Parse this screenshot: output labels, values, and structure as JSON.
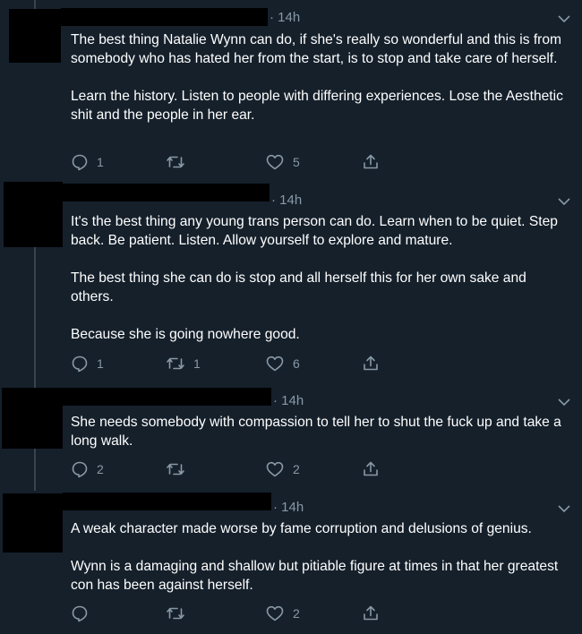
{
  "tweets": [
    {
      "time": "· 14h",
      "paragraphs": [
        "The best thing Natalie Wynn can do, if she's really so wonderful and this is from somebody who has hated her from the start, is to stop and take care of herself.",
        "Learn the history. Listen to people with differing experiences. Lose the Aesthetic shit and the people in her ear."
      ],
      "replies": "1",
      "retweets": "",
      "likes": "5"
    },
    {
      "time": "· 14h",
      "paragraphs": [
        "It's the best thing any young trans person can do. Learn when to be quiet. Step back. Be patient. Listen. Allow yourself to explore and mature.",
        "The best thing she can do is stop and all herself this for her own sake and others.",
        "Because she is going nowhere good."
      ],
      "replies": "1",
      "retweets": "1",
      "likes": "6"
    },
    {
      "time": "· 14h",
      "paragraphs": [
        "She needs somebody with compassion to tell her to shut the fuck up and take a long walk."
      ],
      "replies": "2",
      "retweets": "",
      "likes": "2"
    },
    {
      "time": "· 14h",
      "paragraphs": [
        "A weak character made worse by fame corruption and delusions of genius.",
        "Wynn is a damaging and shallow but pitiable figure at times in that her greatest con has been against herself."
      ],
      "replies": "",
      "retweets": "",
      "likes": "2"
    }
  ],
  "icons": {
    "reply": "reply-icon",
    "retweet": "retweet-icon",
    "like": "heart-icon",
    "share": "share-icon",
    "caret": "chevron-down-icon"
  },
  "colors": {
    "background": "#15202b",
    "text": "#ffffff",
    "muted": "#8899a6",
    "thread_line": "#38444d"
  }
}
